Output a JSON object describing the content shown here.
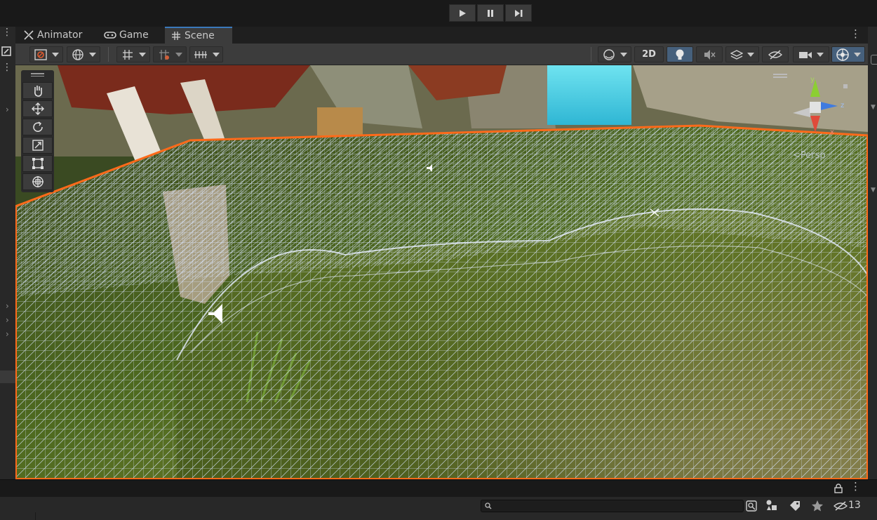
{
  "tabs": [
    {
      "label": "Animator",
      "icon": "animator-icon"
    },
    {
      "label": "Game",
      "icon": "gamepad-icon"
    },
    {
      "label": "Scene",
      "icon": "grid-icon",
      "active": true
    }
  ],
  "playbar": {
    "play": "play-icon",
    "pause": "pause-icon",
    "step": "step-icon"
  },
  "toolbar": {
    "mode_2d_label": "2D",
    "accent_color": "#46607c"
  },
  "viewport": {
    "projection_label": "<Persp",
    "gizmo_axes": {
      "y": "y",
      "z": "z",
      "x": "x"
    },
    "selection_outline_color": "#ff6a1a",
    "wireframe_color": "#cfe0ff"
  },
  "tool_palette": [
    "hand-tool",
    "move-tool",
    "rotate-tool",
    "scale-tool",
    "rect-tool",
    "transform-tool"
  ],
  "project_bar": {
    "search_placeholder": "",
    "hidden_count": "13"
  }
}
